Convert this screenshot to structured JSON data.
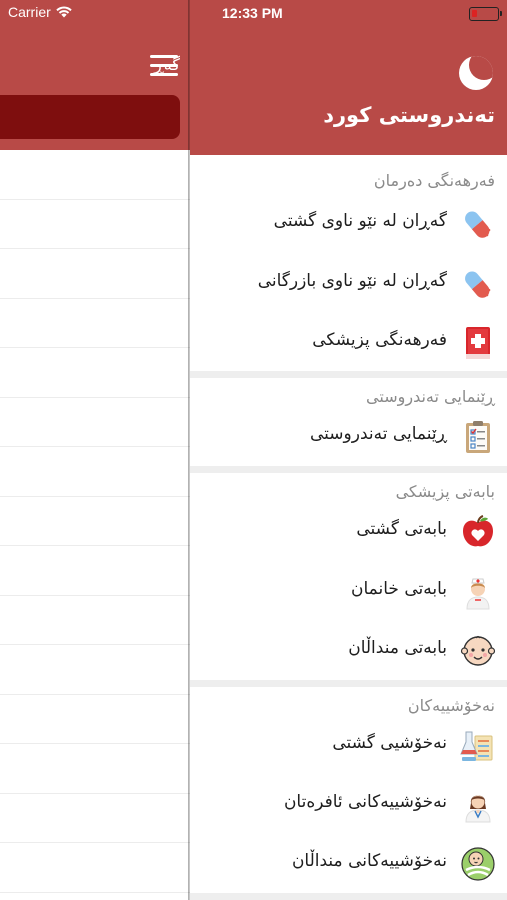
{
  "status": {
    "carrier": "Carrier",
    "time": "12:33 PM"
  },
  "background": {
    "title": "گەڕ"
  },
  "drawer": {
    "app_title": "تەندروستی کورد",
    "sections": [
      {
        "title": "فەرهەنگی دەرمان",
        "items": [
          {
            "label": "گەڕان لە نێو ناوی گشتی",
            "icon": "pill-capsule-icon"
          },
          {
            "label": "گەڕان لە نێو ناوی بازرگانی",
            "icon": "pill-capsule-icon"
          },
          {
            "label": "فەرهەنگی پزیشکی",
            "icon": "medical-book-icon"
          }
        ]
      },
      {
        "title": "ڕێنمایی تەندروستی",
        "items": [
          {
            "label": "ڕێنمایی تەندروستی",
            "icon": "clipboard-icon"
          }
        ]
      },
      {
        "title": "بابەتی پزیشکی",
        "items": [
          {
            "label": "بابەتی گشتی",
            "icon": "apple-heart-icon"
          },
          {
            "label": "بابەتی خانمان",
            "icon": "nurse-icon"
          },
          {
            "label": "بابەتی منداڵان",
            "icon": "baby-face-icon"
          }
        ]
      },
      {
        "title": "نەخۆشییەکان",
        "items": [
          {
            "label": "نەخۆشیی گشتی",
            "icon": "lab-tubes-icon"
          },
          {
            "label": "نەخۆشییەکانی ئافرەتان",
            "icon": "female-doctor-icon"
          },
          {
            "label": "نەخۆشییەکانی منداڵان",
            "icon": "swaddled-baby-icon"
          }
        ]
      }
    ]
  }
}
